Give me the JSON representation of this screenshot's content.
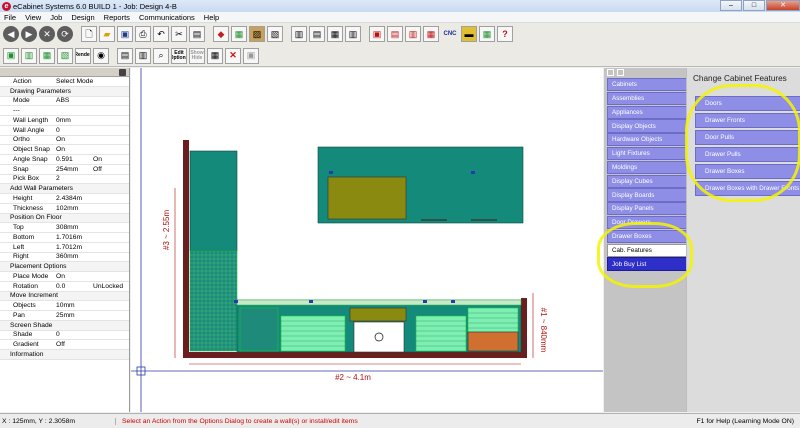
{
  "window": {
    "title": "eCabinet Systems 6.0 BUILD 1 - Job: Design 4-B",
    "minimize": "–",
    "maximize": "□",
    "close": "✕"
  },
  "menu": [
    "File",
    "View",
    "Job",
    "Design",
    "Reports",
    "Communications",
    "Help"
  ],
  "toolbar": {
    "render_label": "Render",
    "edit_options_label": "Edit Options",
    "show_hide_label": "Show Hide",
    "cnc_label": "CNC"
  },
  "left_panel": {
    "rows": [
      {
        "type": "pair",
        "label": "Action",
        "value": "Select Mode",
        "extra": ""
      },
      {
        "type": "section",
        "label": "Drawing Parameters"
      },
      {
        "type": "pair",
        "label": "Mode",
        "value": "ABS",
        "extra": ""
      },
      {
        "type": "pair",
        "label": "---",
        "value": "",
        "extra": ""
      },
      {
        "type": "pair",
        "label": "Wall Length",
        "value": "0mm",
        "extra": ""
      },
      {
        "type": "pair",
        "label": "Wall Angle",
        "value": "0",
        "extra": ""
      },
      {
        "type": "pair",
        "label": "Ortho",
        "value": "On",
        "extra": ""
      },
      {
        "type": "pair",
        "label": "Object Snap",
        "value": "On",
        "extra": ""
      },
      {
        "type": "pair",
        "label": "Angle Snap",
        "value": "0.591",
        "extra": "On"
      },
      {
        "type": "pair",
        "label": "Snap",
        "value": "254mm",
        "extra": "Off"
      },
      {
        "type": "pair",
        "label": "Pick Box",
        "value": "2",
        "extra": ""
      },
      {
        "type": "section",
        "label": "Add Wall Parameters"
      },
      {
        "type": "pair",
        "label": "Height",
        "value": "2.4384m",
        "extra": ""
      },
      {
        "type": "pair",
        "label": "Thickness",
        "value": "102mm",
        "extra": ""
      },
      {
        "type": "section",
        "label": "Position On Floor"
      },
      {
        "type": "pair",
        "label": "Top",
        "value": "308mm",
        "extra": ""
      },
      {
        "type": "pair",
        "label": "Bottom",
        "value": "1.7016m",
        "extra": ""
      },
      {
        "type": "pair",
        "label": "Left",
        "value": "1.7012m",
        "extra": ""
      },
      {
        "type": "pair",
        "label": "Right",
        "value": "360mm",
        "extra": ""
      },
      {
        "type": "section",
        "label": "Placement Options"
      },
      {
        "type": "pair",
        "label": "Place Mode",
        "value": "On",
        "extra": ""
      },
      {
        "type": "pair",
        "label": "Rotation",
        "value": "0.0",
        "extra": "UnLocked"
      },
      {
        "type": "section",
        "label": "Move Increment"
      },
      {
        "type": "pair",
        "label": "Objects",
        "value": "10mm",
        "extra": ""
      },
      {
        "type": "pair",
        "label": "Pan",
        "value": "25mm",
        "extra": ""
      },
      {
        "type": "section",
        "label": "Screen Shade"
      },
      {
        "type": "pair",
        "label": "Shade",
        "value": "0",
        "extra": ""
      },
      {
        "type": "pair",
        "label": "Gradient",
        "value": "Off",
        "extra": ""
      },
      {
        "type": "section",
        "label": "Information"
      }
    ]
  },
  "canvas": {
    "dim_left": "#3 ~ 2.55m",
    "dim_bottom": "#2 ~ 4.1m",
    "dim_right": "#1 ~ 840mm"
  },
  "right_panel": {
    "categories": [
      {
        "label": "Cabinets",
        "state": "normal"
      },
      {
        "label": "Assemblies",
        "state": "normal"
      },
      {
        "label": "Appliances",
        "state": "normal"
      },
      {
        "label": "Display Objects",
        "state": "normal"
      },
      {
        "label": "Hardware Objects",
        "state": "normal"
      },
      {
        "label": "Light Fixtures",
        "state": "normal"
      },
      {
        "label": "Moldings",
        "state": "normal"
      },
      {
        "label": "Display Cubes",
        "state": "normal"
      },
      {
        "label": "Display Boards",
        "state": "normal"
      },
      {
        "label": "Display Panels",
        "state": "normal"
      },
      {
        "label": "Door Drawers",
        "state": "normal"
      },
      {
        "label": "Drawer Boxes",
        "state": "normal"
      },
      {
        "label": "Cab. Features",
        "state": "active"
      },
      {
        "label": "Job Buy List",
        "state": "jobbuy"
      }
    ],
    "feature_title": "Change Cabinet Features",
    "features": [
      "Doors",
      "Drawer Fronts",
      "Door Pulls",
      "Drawer Pulls",
      "Drawer Boxes",
      "Drawer Boxes with Drawer Fronts"
    ]
  },
  "status": {
    "coords": "X : 125mm, Y : 2.3058m",
    "message": "Select an Action from the Options Dialog to create a wall(s) or install/edit items",
    "help": "F1 for Help (Learning Mode ON)"
  },
  "colors": {
    "cabinet_teal": "#148a7a",
    "cabinet_green": "#7cf0b0",
    "door_olive": "#8a8a10",
    "wall_brown": "#6b1e1e",
    "category_blue": "#8e8ee6",
    "highlight_yellow": "#f5f500"
  }
}
